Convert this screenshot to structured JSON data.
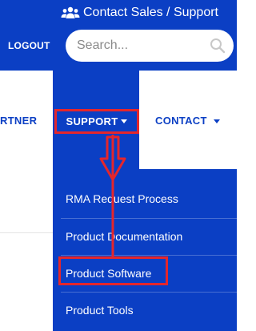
{
  "header": {
    "contact_sales": "Contact Sales / Support",
    "logout_label": "LOGOUT",
    "search_placeholder": "Search..."
  },
  "nav": {
    "partner_label": "RTNER",
    "support_label": "SUPPORT",
    "contact_label": "CONTACT"
  },
  "dropdown": {
    "items": [
      {
        "label": "RMA Request Process"
      },
      {
        "label": "Product Documentation"
      },
      {
        "label": "Product Software"
      },
      {
        "label": "Product Tools"
      }
    ]
  },
  "colors": {
    "brand_blue": "#0b3fc4",
    "annotation_red": "#e4262c",
    "text_white": "#ffffff"
  },
  "icons": [
    "users-icon",
    "search-icon",
    "caret-down-icon"
  ]
}
